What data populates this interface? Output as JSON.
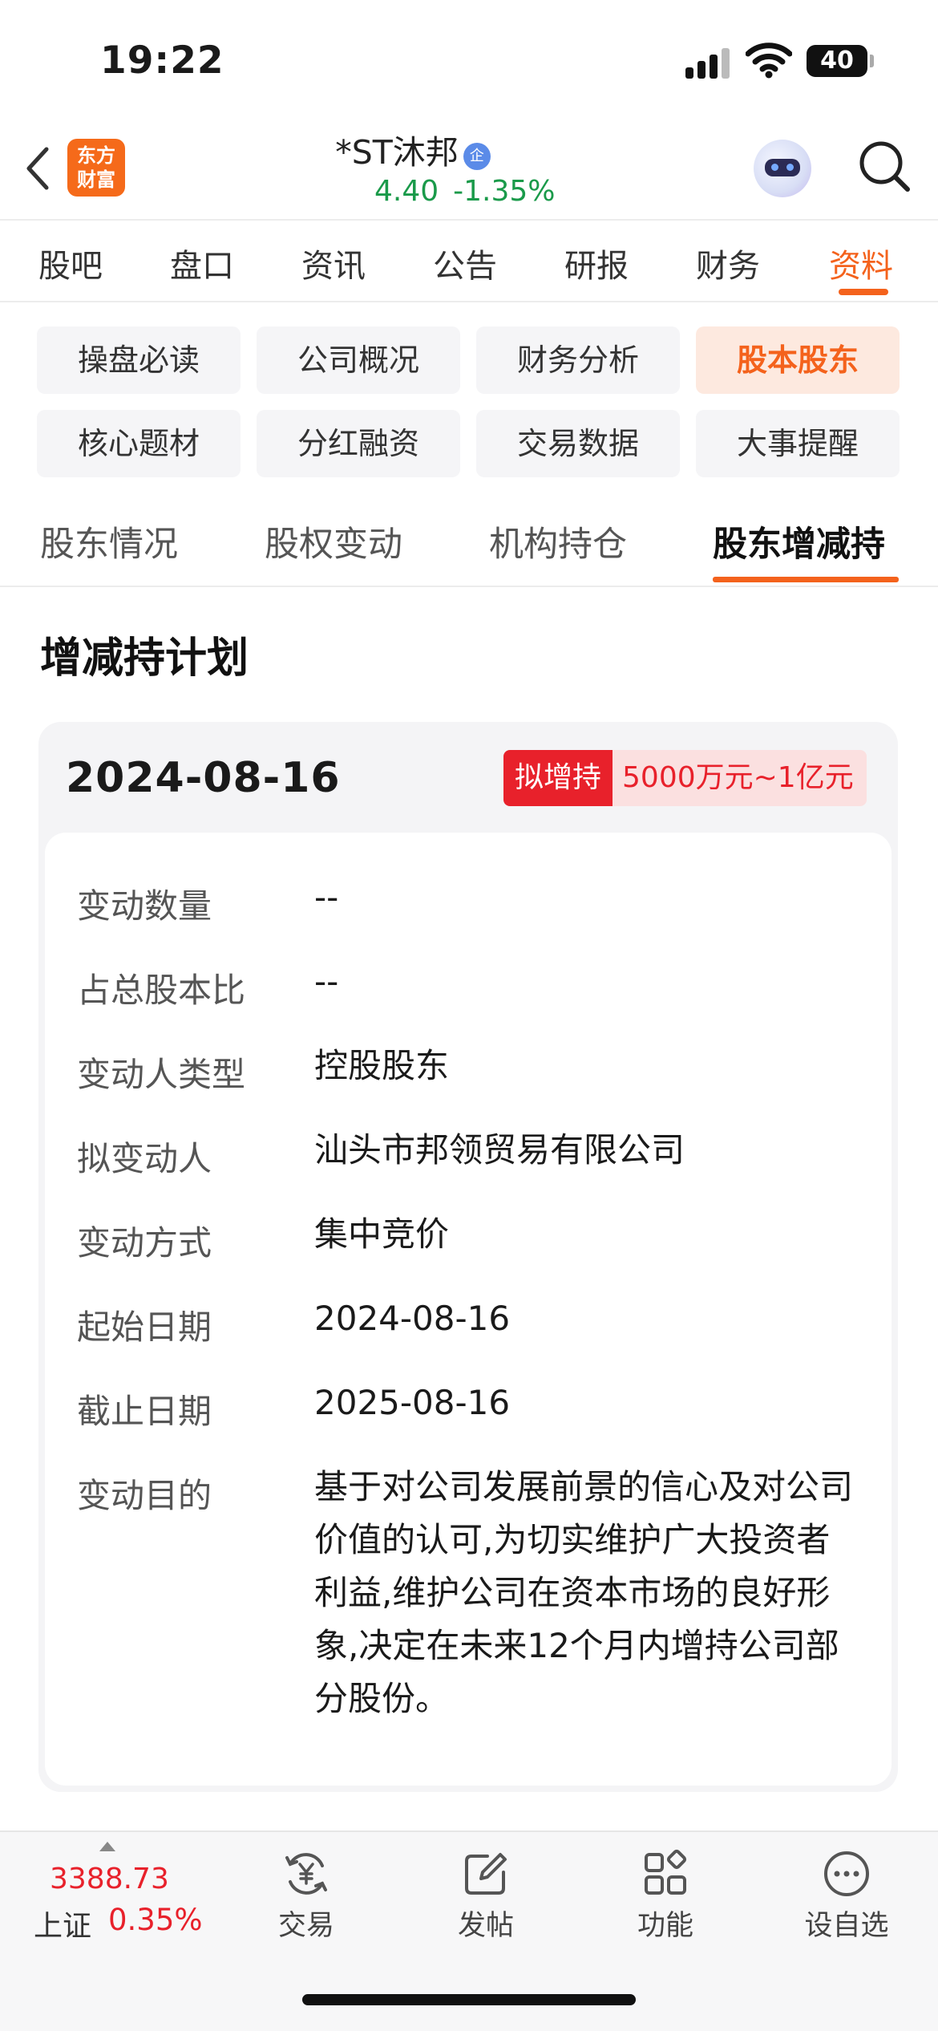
{
  "status_bar": {
    "time": "19:22",
    "battery": "40"
  },
  "header": {
    "logo_line1": "东方",
    "logo_line2": "财富",
    "stock_name": "*ST沐邦",
    "verified_badge": "企",
    "price": "4.40",
    "change_pct": "-1.35%",
    "price_color": "#1a9a4a"
  },
  "tabs": [
    {
      "label": "股吧"
    },
    {
      "label": "盘口"
    },
    {
      "label": "资讯"
    },
    {
      "label": "公告"
    },
    {
      "label": "研报"
    },
    {
      "label": "财务"
    },
    {
      "label": "资料",
      "active": true
    }
  ],
  "chips": [
    {
      "label": "操盘必读"
    },
    {
      "label": "公司概况"
    },
    {
      "label": "财务分析"
    },
    {
      "label": "股本股东",
      "active": true
    },
    {
      "label": "核心题材"
    },
    {
      "label": "分红融资"
    },
    {
      "label": "交易数据"
    },
    {
      "label": "大事提醒"
    }
  ],
  "subtabs": [
    {
      "label": "股东情况"
    },
    {
      "label": "股权变动"
    },
    {
      "label": "机构持仓"
    },
    {
      "label": "股东增减持",
      "active": true
    }
  ],
  "section_title": "增减持计划",
  "plan": {
    "date": "2024-08-16",
    "type": "拟增持",
    "amount": "5000万元~1亿元",
    "rows": [
      {
        "label": "变动数量",
        "value": "--"
      },
      {
        "label": "占总股本比",
        "value": "--"
      },
      {
        "label": "变动人类型",
        "value": "控股股东"
      },
      {
        "label": "拟变动人",
        "value": "汕头市邦领贸易有限公司"
      },
      {
        "label": "变动方式",
        "value": "集中竞价"
      },
      {
        "label": "起始日期",
        "value": "2024-08-16"
      },
      {
        "label": "截止日期",
        "value": "2025-08-16"
      },
      {
        "label": "变动目的",
        "value": "基于对公司发展前景的信心及对公司价值的认可,为切实维护广大投资者利益,维护公司在资本市场的良好形象,决定在未来12个月内增持公司部分股份。"
      }
    ]
  },
  "bottom_bar": {
    "index_value": "3388.73",
    "index_name": "上证",
    "index_change": "0.35%",
    "items": [
      {
        "label": "交易",
        "icon": "yuan-exchange-icon"
      },
      {
        "label": "发帖",
        "icon": "edit-icon"
      },
      {
        "label": "功能",
        "icon": "grid-icon"
      },
      {
        "label": "设自选",
        "icon": "more-circle-icon"
      }
    ]
  },
  "colors": {
    "accent": "#f4621c",
    "down": "#1a9a4a",
    "up": "#e8212b"
  }
}
